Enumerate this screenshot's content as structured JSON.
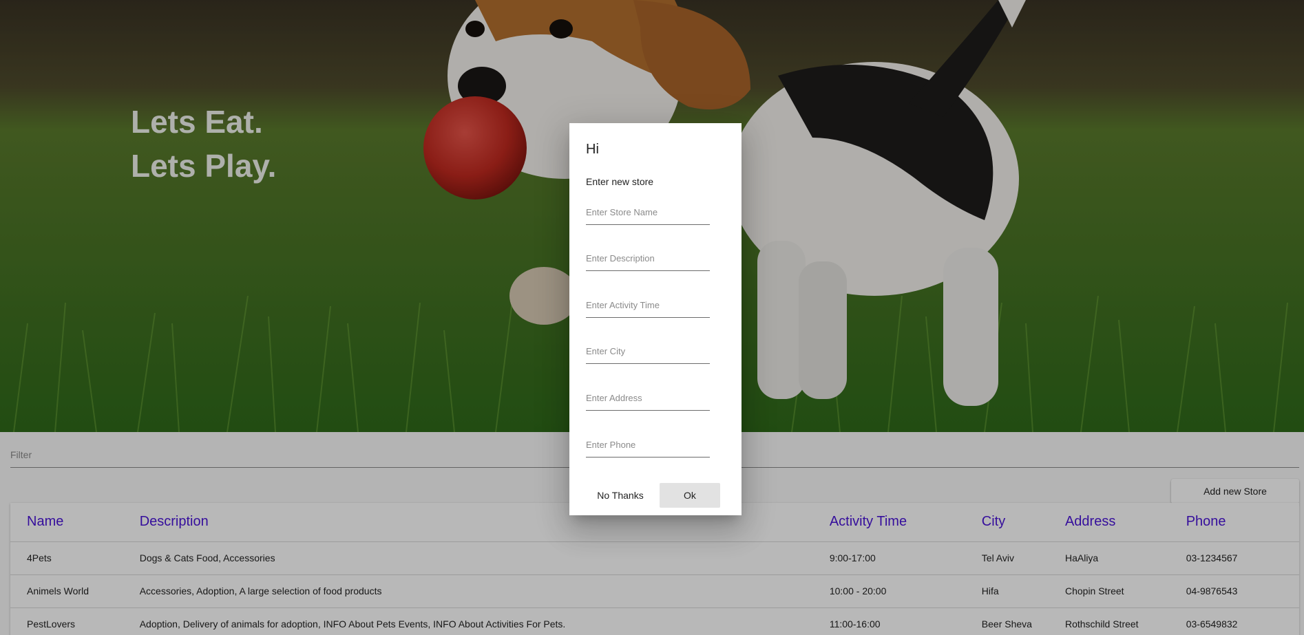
{
  "hero": {
    "line1": "Lets Eat.",
    "line2": "Lets Play.",
    "image": "beagle-puppy-with-red-ball-on-grass"
  },
  "filter": {
    "placeholder": "Filter"
  },
  "toolbar": {
    "add_store_label": "Add new Store"
  },
  "table": {
    "columns": [
      "Name",
      "Description",
      "Activity Time",
      "City",
      "Address",
      "Phone"
    ],
    "rows": [
      [
        "4Pets",
        "Dogs & Cats Food, Accessories",
        "9:00-17:00",
        "Tel Aviv",
        "HaAliya",
        "03-1234567"
      ],
      [
        "Animels World",
        "Accessories, Adoption, A large selection of food products",
        "10:00 - 20:00",
        "Hifa",
        "Chopin Street",
        "04-9876543"
      ],
      [
        "PestLovers",
        "Adoption, Delivery of animals for adoption, INFO About Pets Events, INFO About Activities For Pets.",
        "11:00-16:00",
        "Beer Sheva",
        "Rothschild Street",
        "03-6549832"
      ]
    ]
  },
  "dialog": {
    "title": "Hi",
    "subtitle": "Enter new store",
    "fields": [
      {
        "placeholder": "Enter Store Name",
        "value": ""
      },
      {
        "placeholder": "Enter Description",
        "value": ""
      },
      {
        "placeholder": "Enter Activity Time",
        "value": ""
      },
      {
        "placeholder": "Enter City",
        "value": ""
      },
      {
        "placeholder": "Enter Address",
        "value": ""
      },
      {
        "placeholder": "Enter Phone",
        "value": ""
      }
    ],
    "cancel_label": "No Thanks",
    "ok_label": "Ok"
  },
  "colors": {
    "header_text": "#4a14d8",
    "overlay": "rgba(0,0,0,0.28)"
  }
}
